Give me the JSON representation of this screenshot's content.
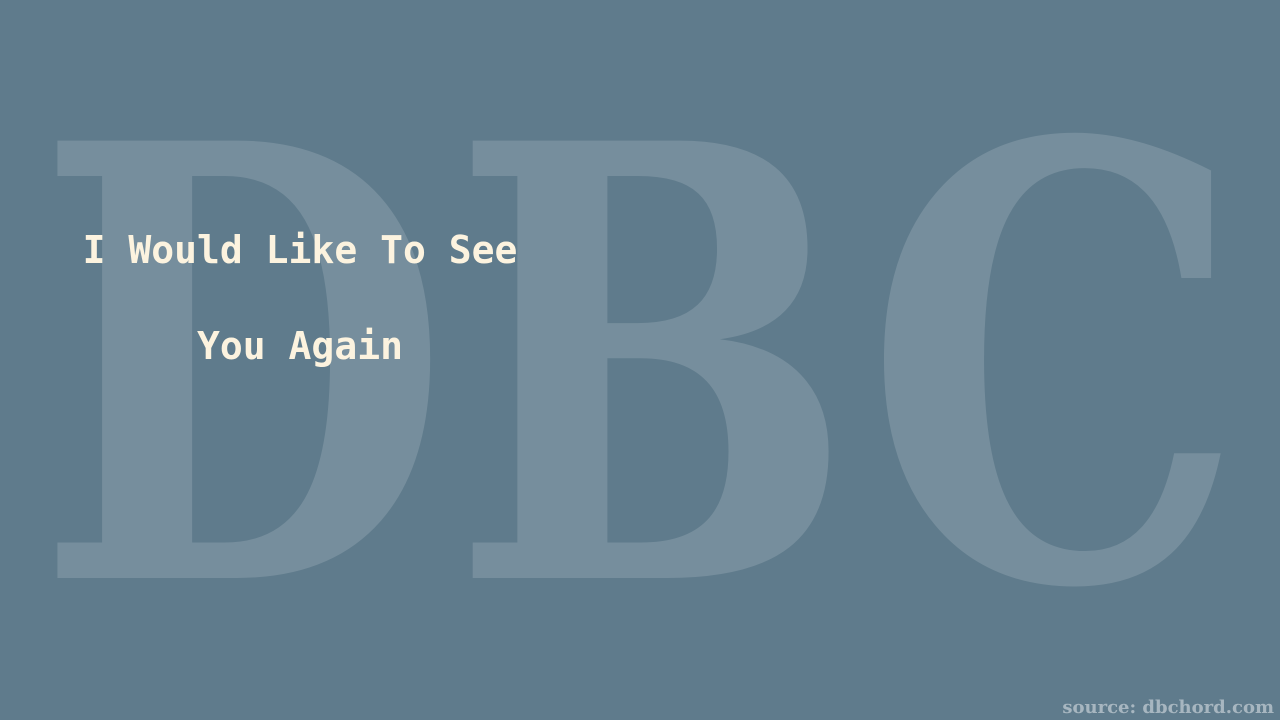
{
  "watermark": {
    "text": "DBC"
  },
  "lyrics": {
    "line1": "I Would Like To See",
    "line2": "You Again"
  },
  "source": {
    "label": "source: dbchord.com"
  },
  "colors": {
    "background": "#5f7b8c",
    "lyric_text": "#fcf3df",
    "watermark": "rgba(255,255,255,0.15)"
  }
}
